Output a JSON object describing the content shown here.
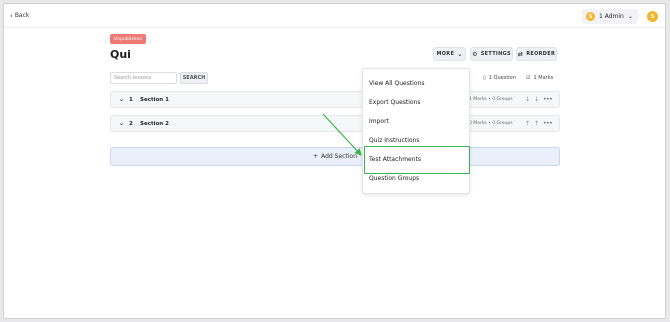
{
  "topbar": {
    "back_label": "Back",
    "admin_label": "1 Admin",
    "coin_letter": "S",
    "avatar_letter": "S"
  },
  "quiz": {
    "status_badge": "Unpublished",
    "title": "Qui"
  },
  "toolbar": {
    "more_label": "MORE",
    "settings_label": "SETTINGS",
    "reorder_label": "REORDER"
  },
  "search": {
    "placeholder": "Search lessons",
    "button_label": "SEARCH"
  },
  "stats": {
    "questions": "1 Question",
    "marks": "1 Marks"
  },
  "sections": [
    {
      "number": "1",
      "name": "Section 1",
      "meta": "1 Marks • 0 Groups"
    },
    {
      "number": "2",
      "name": "Section 2",
      "meta": "0 Marks • 0 Groups"
    }
  ],
  "add_section_label": "Add Section",
  "more_menu": {
    "items": [
      "View All Questions",
      "Export Questions",
      "Import",
      "Quiz Instructions",
      "Test Attachments",
      "Question Groups"
    ],
    "highlighted_index": 4
  },
  "colors": {
    "badge": "#f07a73",
    "accent_yellow": "#f5b52e",
    "annotation_green": "#3cb44b",
    "add_section_bg": "#eaf0fb"
  }
}
